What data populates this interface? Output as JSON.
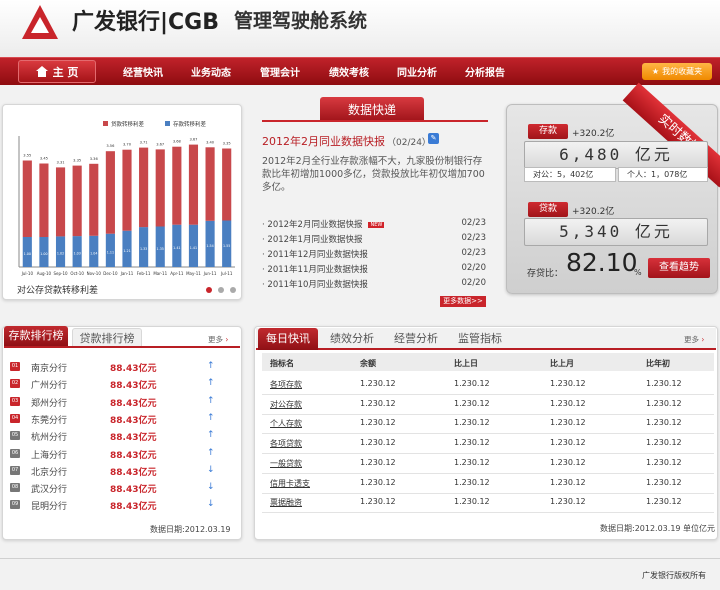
{
  "header": {
    "bank_name": "广发银行|CGB",
    "system_title": "管理驾驶舱系统"
  },
  "nav": {
    "home": "主 页",
    "items": [
      "经营快讯",
      "业务动态",
      "管理会计",
      "绩效考核",
      "同业分析",
      "分析报告"
    ],
    "favorites": "我的收藏夹"
  },
  "chart_data": {
    "type": "bar",
    "title": "",
    "caption": "对公存贷款转移利差",
    "categories": [
      "Jul-10",
      "Aug-10",
      "Sep-10",
      "Oct-10",
      "Nov-10",
      "Dec-10",
      "Jan-11",
      "Feb-11",
      "Mar-11",
      "Apr-11",
      "May-11",
      "Jun-11",
      "Jul-11"
    ],
    "series": [
      {
        "name": "贷款转移利差",
        "color": "#c8484b",
        "values": [
          2.55,
          2.45,
          2.3,
          2.35,
          2.4,
          2.75,
          2.7,
          2.65,
          2.57,
          2.6,
          2.67,
          2.45,
          2.4
        ]
      },
      {
        "name": "存款转移利差",
        "color": "#4a7fc1",
        "values": [
          1.0,
          1.0,
          1.02,
          1.03,
          1.04,
          1.11,
          1.21,
          1.33,
          1.35,
          1.41,
          1.41,
          1.54,
          1.55
        ]
      }
    ],
    "top_labels": [
      "3.55",
      "3.45",
      "3.31",
      "3.35",
      "3.36",
      "3.56",
      "3.70",
      "3.71",
      "3.67",
      "3.68",
      "3.67",
      "3.40",
      "3.35"
    ],
    "ylim": [
      0,
      4.2
    ],
    "legend": "top"
  },
  "news": {
    "tab": "数据快递",
    "headline": "2012年2月同业数据快报",
    "headline_date": "（02/24）",
    "body": "2012年2月全行业存款涨幅不大，九家股份制银行存款比年初增加1000多亿，贷款投放比年初仅增加700多亿。",
    "items": [
      {
        "title": "2012年2月同业数据快报",
        "date": "02/23",
        "is_new": true
      },
      {
        "title": "2012年1月同业数据快报",
        "date": "02/23",
        "is_new": false
      },
      {
        "title": "2011年12月同业数据快报",
        "date": "02/23",
        "is_new": false
      },
      {
        "title": "2011年11月同业数据快报",
        "date": "02/20",
        "is_new": false
      },
      {
        "title": "2011年10月同业数据快报",
        "date": "02/20",
        "is_new": false
      }
    ],
    "new_badge": "NEW",
    "more": "更多数据>>"
  },
  "realtime": {
    "ribbon": "实时数据",
    "deposit": {
      "tag": "存款",
      "delta": "+320.2亿",
      "value": "6,480 亿元",
      "corporate": "对公：5，402亿",
      "personal": "个人：1，078亿"
    },
    "loan": {
      "tag": "贷款",
      "delta": "+320.2亿",
      "value": "5,340 亿元"
    },
    "ratio_label": "存贷比：",
    "ratio_value": "82.10",
    "ratio_unit": "%",
    "trend_button": "查看趋势"
  },
  "ranking": {
    "tabs": [
      "存款排行榜",
      "贷款排行榜"
    ],
    "more": "更多",
    "rows": [
      {
        "badge": "01",
        "name": "南京分行",
        "value": "88.43亿元",
        "trend": "up"
      },
      {
        "badge": "02",
        "name": "广州分行",
        "value": "88.43亿元",
        "trend": "up"
      },
      {
        "badge": "03",
        "name": "郑州分行",
        "value": "88.43亿元",
        "trend": "up"
      },
      {
        "badge": "04",
        "name": "东莞分行",
        "value": "88.43亿元",
        "trend": "up"
      },
      {
        "badge": "05",
        "name": "杭州分行",
        "value": "88.43亿元",
        "trend": "up"
      },
      {
        "badge": "06",
        "name": "上海分行",
        "value": "88.43亿元",
        "trend": "up"
      },
      {
        "badge": "07",
        "name": "北京分行",
        "value": "88.43亿元",
        "trend": "down"
      },
      {
        "badge": "08",
        "name": "武汉分行",
        "value": "88.43亿元",
        "trend": "down"
      },
      {
        "badge": "09",
        "name": "昆明分行",
        "value": "88.43亿元",
        "trend": "down"
      }
    ],
    "date": "数据日期:2012.03.19"
  },
  "daily": {
    "tabs": [
      "每日快讯",
      "绩效分析",
      "经营分析",
      "监管指标"
    ],
    "more": "更多",
    "columns": [
      "指标名",
      "余额",
      "比上日",
      "比上月",
      "比年初"
    ],
    "rows": [
      {
        "name": "各项存款",
        "values": [
          "1.230.12",
          "1.230.12",
          "1.230.12",
          "1.230.12"
        ]
      },
      {
        "name": "对公存款",
        "values": [
          "1.230.12",
          "1.230.12",
          "1.230.12",
          "1.230.12"
        ]
      },
      {
        "name": "个人存款",
        "values": [
          "1.230.12",
          "1.230.12",
          "1.230.12",
          "1.230.12"
        ]
      },
      {
        "name": "各项贷款",
        "values": [
          "1.230.12",
          "1.230.12",
          "1.230.12",
          "1.230.12"
        ]
      },
      {
        "name": "一般贷款",
        "values": [
          "1.230.12",
          "1.230.12",
          "1.230.12",
          "1.230.12"
        ]
      },
      {
        "name": "信用卡透支",
        "values": [
          "1.230.12",
          "1.230.12",
          "1.230.12",
          "1.230.12"
        ]
      },
      {
        "name": "票据融资",
        "values": [
          "1.230.12",
          "1.230.12",
          "1.230.12",
          "1.230.12"
        ]
      }
    ],
    "footer": "数据日期:2012.03.19 单位亿元"
  },
  "footer": {
    "copyright": "广发银行版权所有"
  }
}
